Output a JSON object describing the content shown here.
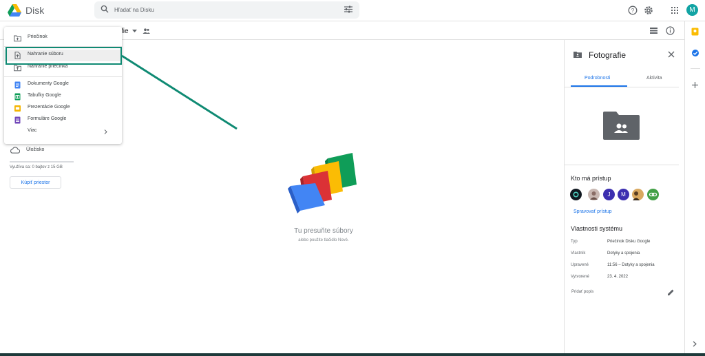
{
  "header": {
    "brand": "Disk",
    "search_placeholder": "Hľadať na Disku",
    "avatar_letter": "M"
  },
  "toolbar": {
    "crumb_tail": "fie"
  },
  "menu": {
    "items": [
      {
        "label": "Priečinok"
      },
      {
        "label": "Nahranie súboru"
      },
      {
        "label": "Nahranie priečinka"
      },
      {
        "label": "Dokumenty Google"
      },
      {
        "label": "Tabuľky Google"
      },
      {
        "label": "Prezentácie Google"
      },
      {
        "label": "Formuláre Google"
      },
      {
        "label": "Viac"
      }
    ]
  },
  "sidebar": {
    "storage_label": "Úložisko",
    "storage_usage": "Využíva sa: 0 bajtov z 15 GB",
    "buy_label": "Kúpiť priestor"
  },
  "main": {
    "empty_title": "Tu presuňte súbory",
    "empty_sub": "alebo použite tlačidlo Nové."
  },
  "panel": {
    "title": "Fotografie",
    "tabs": [
      {
        "label": "Podrobnosti"
      },
      {
        "label": "Aktivita"
      }
    ],
    "access_title": "Kto má prístup",
    "avatars": [
      {
        "letter": "J",
        "color": "#3c2fb0"
      },
      {
        "letter": "M",
        "color": "#3c2fb0"
      }
    ],
    "manage_label": "Spravovať prístup",
    "props_title": "Vlastnosti systému",
    "props": [
      {
        "key": "Typ",
        "value": "Priečinok Disku Google"
      },
      {
        "key": "Vlastník",
        "value": "Dotyky a spojenia"
      },
      {
        "key": "Upravené",
        "value": "11:56 – Dotyky a spojenia"
      },
      {
        "key": "Vytvorené",
        "value": "23. 4. 2022"
      }
    ],
    "add_description": "Pridať popis"
  },
  "colors": {
    "accent": "#1a73e8",
    "highlight": "#0f8a73"
  }
}
